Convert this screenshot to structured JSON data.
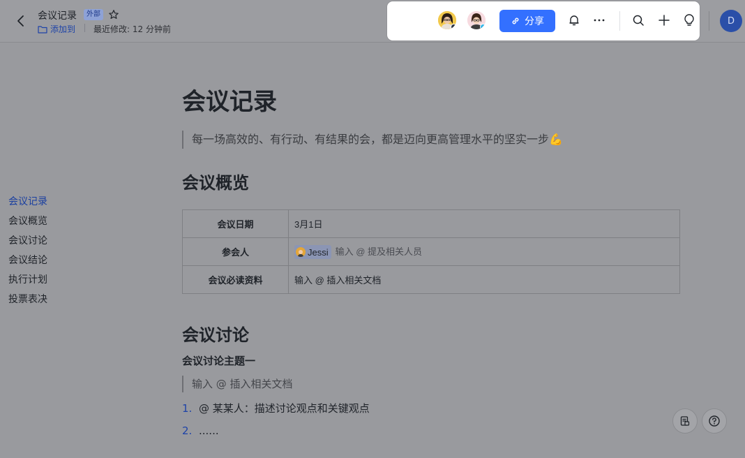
{
  "header": {
    "doc_title": "会议记录",
    "external_badge": "外部",
    "add_to_label": "添加到",
    "last_modified": "最近修改: 12 分钟前"
  },
  "toolbar": {
    "share_label": "分享",
    "user_initial": "D",
    "icons": [
      "bell-icon",
      "more-icon",
      "search-icon",
      "plus-icon",
      "bulb-icon"
    ],
    "share_color": "#3370ff"
  },
  "outline": {
    "items": [
      {
        "label": "会议记录",
        "active": true
      },
      {
        "label": "会议概览",
        "active": false
      },
      {
        "label": "会议讨论",
        "active": false
      },
      {
        "label": "会议结论",
        "active": false
      },
      {
        "label": "执行计划",
        "active": false
      },
      {
        "label": "投票表决",
        "active": false
      }
    ]
  },
  "document": {
    "title": "会议记录",
    "intro_quote": "每一场高效的、有行动、有结果的会，都是迈向更高管理水平的坚实一步💪",
    "overview_heading": "会议概览",
    "meta_table": [
      {
        "key": "会议日期",
        "value": "3月1日"
      },
      {
        "key": "参会人",
        "mention": "Jessi",
        "placeholder": "输入 @ 提及相关人员"
      },
      {
        "key": "会议必读资料",
        "placeholder": "输入 @ 插入相关文档"
      }
    ],
    "discussion_heading": "会议讨论",
    "topic_heading": "会议讨论主题一",
    "topic_quote": "输入 @ 插入相关文档",
    "list": [
      {
        "num": "1.",
        "text": "@ 某某人：描述讨论观点和关键观点"
      },
      {
        "num": "2.",
        "text": "......"
      }
    ]
  }
}
